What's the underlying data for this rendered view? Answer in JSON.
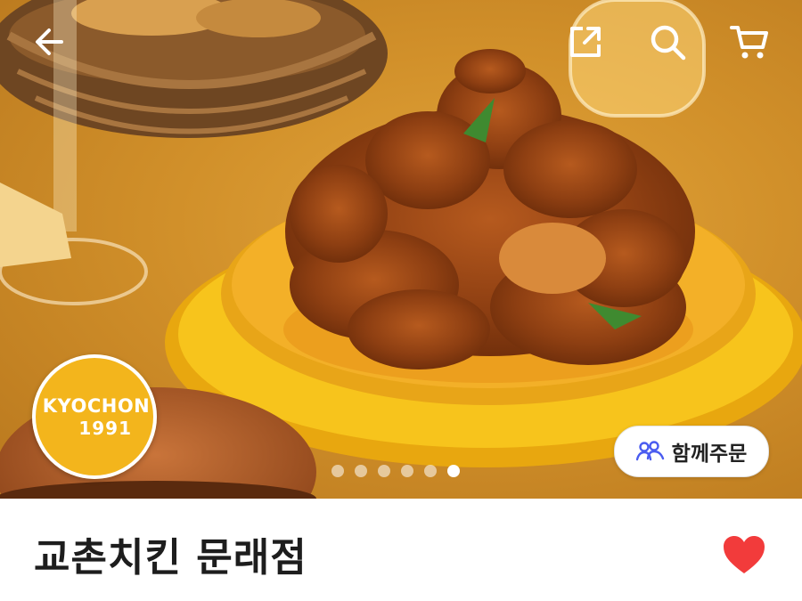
{
  "header": {
    "back_icon": "arrow-left-icon",
    "share_icon": "share-icon",
    "search_icon": "search-icon",
    "cart_icon": "cart-icon"
  },
  "hero": {
    "logo_line1": "KYOCHON",
    "logo_line2": "1991",
    "carousel": {
      "total": 6,
      "active_index": 5
    },
    "group_order_label": "함께주문",
    "group_order_icon": "group-users-icon"
  },
  "store": {
    "name": "교촌치킨 문래점",
    "favorite_icon": "heart-icon",
    "favorite_color": "#f23b3b"
  },
  "colors": {
    "group_icon": "#4a5cf0",
    "logo_bg": "#f3b51c"
  }
}
